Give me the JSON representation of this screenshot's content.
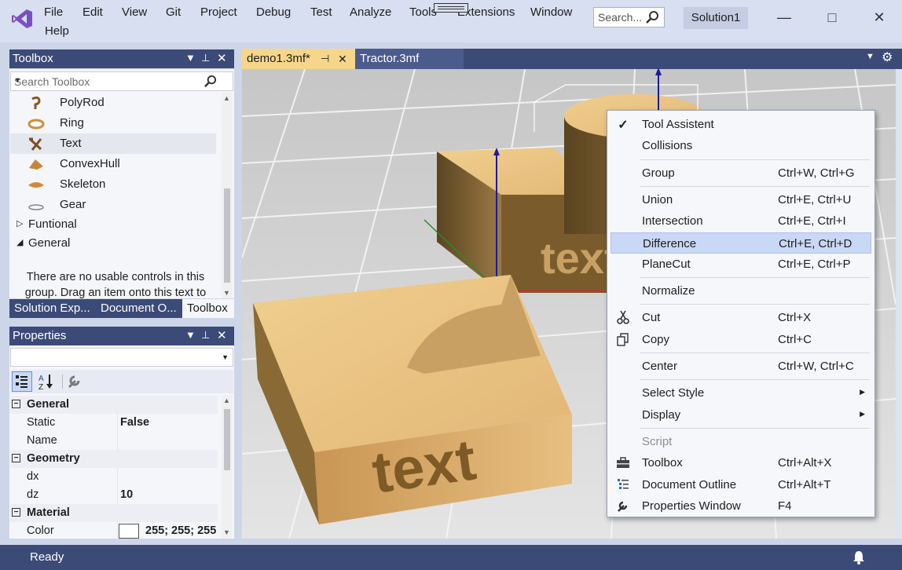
{
  "menubar": {
    "items": [
      "File",
      "Edit",
      "View",
      "Git",
      "Project",
      "Debug",
      "Test",
      "Analyze",
      "Tools",
      "Extensions",
      "Window",
      "Help"
    ],
    "search_placeholder": "Search...",
    "solution_name": "Solution1"
  },
  "toolbox": {
    "title": "Toolbox",
    "search_placeholder": "Search Toolbox",
    "items": [
      {
        "label": "PolyRod",
        "icon": "polyrod-icon"
      },
      {
        "label": "Ring",
        "icon": "ring-icon"
      },
      {
        "label": "Text",
        "icon": "text-shape-icon",
        "selected": true
      },
      {
        "label": "ConvexHull",
        "icon": "convexhull-icon"
      },
      {
        "label": "Skeleton",
        "icon": "skeleton-icon"
      },
      {
        "label": "Gear",
        "icon": "gear-icon"
      }
    ],
    "groups": [
      {
        "label": "Funtional",
        "expanded": false
      },
      {
        "label": "General",
        "expanded": true
      }
    ],
    "empty_message": "There are no usable controls in this group. Drag an item onto this text to add it to the toolbox."
  },
  "bottom_tabs": [
    "Solution Exp...",
    "Document O...",
    "Toolbox"
  ],
  "properties": {
    "title": "Properties",
    "rows": [
      {
        "type": "category",
        "label": "General"
      },
      {
        "type": "prop",
        "label": "Static",
        "value": "False"
      },
      {
        "type": "prop",
        "label": "Name",
        "value": ""
      },
      {
        "type": "category",
        "label": "Geometry"
      },
      {
        "type": "prop",
        "label": "dx",
        "value": ""
      },
      {
        "type": "prop",
        "label": "dz",
        "value": "10"
      },
      {
        "type": "category",
        "label": "Material"
      },
      {
        "type": "prop",
        "label": "Color",
        "value": "255; 255; 255"
      }
    ]
  },
  "document_tabs": [
    {
      "label": "demo1.3mf*",
      "active": true
    },
    {
      "label": "Tractor.3mf",
      "active": false
    }
  ],
  "context_menu": {
    "items": [
      {
        "label": "Tool Assistent",
        "shortcut": "",
        "checked": true
      },
      {
        "label": "Collisions",
        "shortcut": ""
      },
      {
        "sep": true
      },
      {
        "label": "Group",
        "shortcut": "Ctrl+W, Ctrl+G"
      },
      {
        "sep": true
      },
      {
        "label": "Union",
        "shortcut": "Ctrl+E, Ctrl+U"
      },
      {
        "label": "Intersection",
        "shortcut": "Ctrl+E, Ctrl+I"
      },
      {
        "label": "Difference",
        "shortcut": "Ctrl+E, Ctrl+D",
        "highlighted": true
      },
      {
        "label": "PlaneCut",
        "shortcut": "Ctrl+E, Ctrl+P"
      },
      {
        "sep": true
      },
      {
        "label": "Normalize",
        "shortcut": ""
      },
      {
        "sep": true
      },
      {
        "label": "Cut",
        "shortcut": "Ctrl+X",
        "icon": "scissors-icon"
      },
      {
        "label": "Copy",
        "shortcut": "Ctrl+C",
        "icon": "copy-icon"
      },
      {
        "sep": true
      },
      {
        "label": "Center",
        "shortcut": "Ctrl+W, Ctrl+C"
      },
      {
        "sep": true
      },
      {
        "label": "Select Style",
        "shortcut": "",
        "submenu": true
      },
      {
        "label": "Display",
        "shortcut": "",
        "submenu": true
      },
      {
        "sep": true
      },
      {
        "label": "Script",
        "shortcut": "",
        "disabled": true
      },
      {
        "label": "Toolbox",
        "shortcut": "Ctrl+Alt+X",
        "icon": "toolbox-icon"
      },
      {
        "label": "Document Outline",
        "shortcut": "Ctrl+Alt+T",
        "icon": "outline-icon"
      },
      {
        "label": "Properties Window",
        "shortcut": "F4",
        "icon": "wrench-icon"
      }
    ]
  },
  "scene": {
    "front_text": "text",
    "back_text": "text"
  },
  "status": {
    "text": "Ready"
  },
  "colors": {
    "accent": "#3c4a78",
    "highlight": "#c9d8f5",
    "active_tab": "#f5d68a",
    "wood": "#d9b173"
  }
}
